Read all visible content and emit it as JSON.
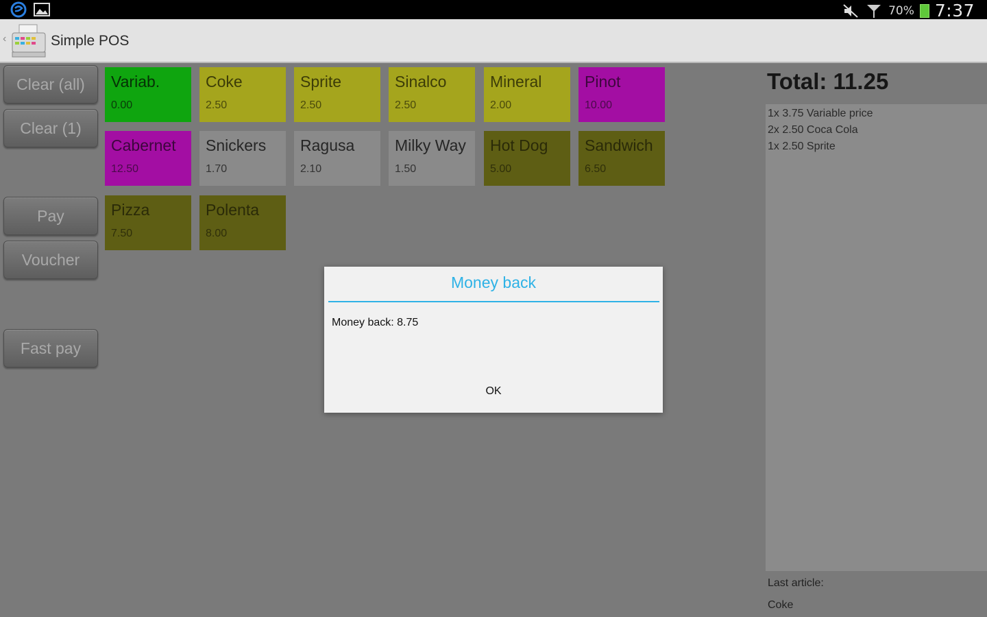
{
  "status_bar": {
    "icons": [
      "s-app-icon",
      "gallery-icon",
      "mute-icon",
      "signal-icon",
      "battery-icon"
    ],
    "battery": "70%",
    "time": "7:37"
  },
  "action_bar": {
    "title": "Simple POS",
    "icon": "cash-register-icon"
  },
  "controls": [
    {
      "label": "Clear (all)"
    },
    {
      "label": "Clear (1)"
    },
    {
      "label": "Pay"
    },
    {
      "label": "Voucher"
    },
    {
      "label": "Fast pay"
    }
  ],
  "products": [
    {
      "name": "Variab.",
      "price": "0.00",
      "color": "#0fa50f"
    },
    {
      "name": "Coke",
      "price": "2.50",
      "color": "#a5a51d"
    },
    {
      "name": "Sprite",
      "price": "2.50",
      "color": "#a5a51d"
    },
    {
      "name": "Sinalco",
      "price": "2.50",
      "color": "#a5a51d"
    },
    {
      "name": "Mineral",
      "price": "2.00",
      "color": "#a5a51d"
    },
    {
      "name": "Pinot",
      "price": "10.00",
      "color": "#a30ea3"
    },
    {
      "name": "Cabernet",
      "price": "12.50",
      "color": "#a30ea3"
    },
    {
      "name": "Snickers",
      "price": "1.70",
      "color": "#8a8a8a"
    },
    {
      "name": "Ragusa",
      "price": "2.10",
      "color": "#8a8a8a"
    },
    {
      "name": "Milky Way",
      "price": "1.50",
      "color": "#8a8a8a"
    },
    {
      "name": "Hot Dog",
      "price": "5.00",
      "color": "#5e5e14"
    },
    {
      "name": "Sandwich",
      "price": "6.50",
      "color": "#5e5e14"
    },
    {
      "name": "Pizza",
      "price": "7.50",
      "color": "#5e5e14"
    },
    {
      "name": "Polenta",
      "price": "8.00",
      "color": "#5e5e14"
    }
  ],
  "total": "Total: 11.25",
  "receipt_lines": [
    "1x 3.75 Variable price",
    "2x 2.50 Coca Cola",
    "1x 2.50 Sprite"
  ],
  "last_article_label": "Last article:",
  "last_article": "Coke",
  "dialog": {
    "title": "Money back",
    "message": "Money back: 8.75",
    "ok_label": "OK",
    "accent": "#2eb2e6"
  }
}
